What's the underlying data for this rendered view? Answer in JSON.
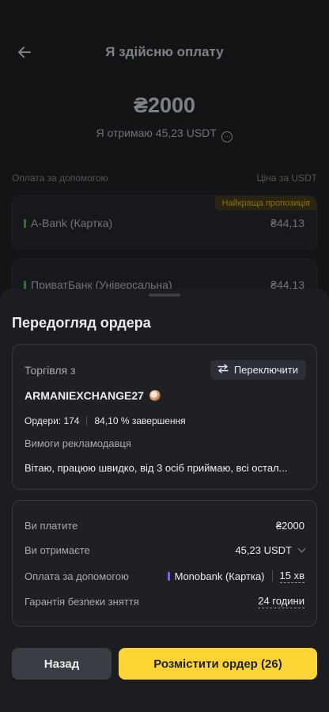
{
  "header": {
    "title": "Я здійсню оплату"
  },
  "summary": {
    "amount": "₴2000",
    "receive_text": "Я отримаю 45,23 USDT",
    "info_glyph": "···"
  },
  "payment_list": {
    "col_left": "Оплата за допомогою",
    "col_right": "Ціна за USDT",
    "best_badge": "Найкраща пропозиція",
    "items": [
      {
        "name": "A-Bank (Картка)",
        "price": "₴44,13"
      },
      {
        "name": "ПриватБанк (Універсальна)",
        "price": "₴44,13"
      }
    ]
  },
  "sheet": {
    "title": "Передогляд ордера",
    "trade": {
      "label": "Торгівля з",
      "switch_label": "Переключити",
      "merchant": "ARMANIEXCHANGE27",
      "orders": "Ордери: 174",
      "completion": "84,10 % завершення",
      "requirements_label": "Вимоги рекламодавця",
      "requirements_text": "Вітаю, працюю швидко, від 3 осіб приймаю, всі остал..."
    },
    "details": {
      "pay_label": "Ви платите",
      "pay_value": "₴2000",
      "get_label": "Ви отримаєте",
      "get_value": "45,23 USDT",
      "method_label": "Оплата за допомогою",
      "method_value": "Monobank (Картка)",
      "method_time": "15 хв",
      "guarantee_label": "Гарантія безпеки зняття",
      "guarantee_value": "24 години"
    },
    "buttons": {
      "back": "Назад",
      "place": "Розмістити ордер (26)"
    }
  },
  "colors": {
    "accent": "#fcd535",
    "method_bar": "#7b61ff"
  }
}
